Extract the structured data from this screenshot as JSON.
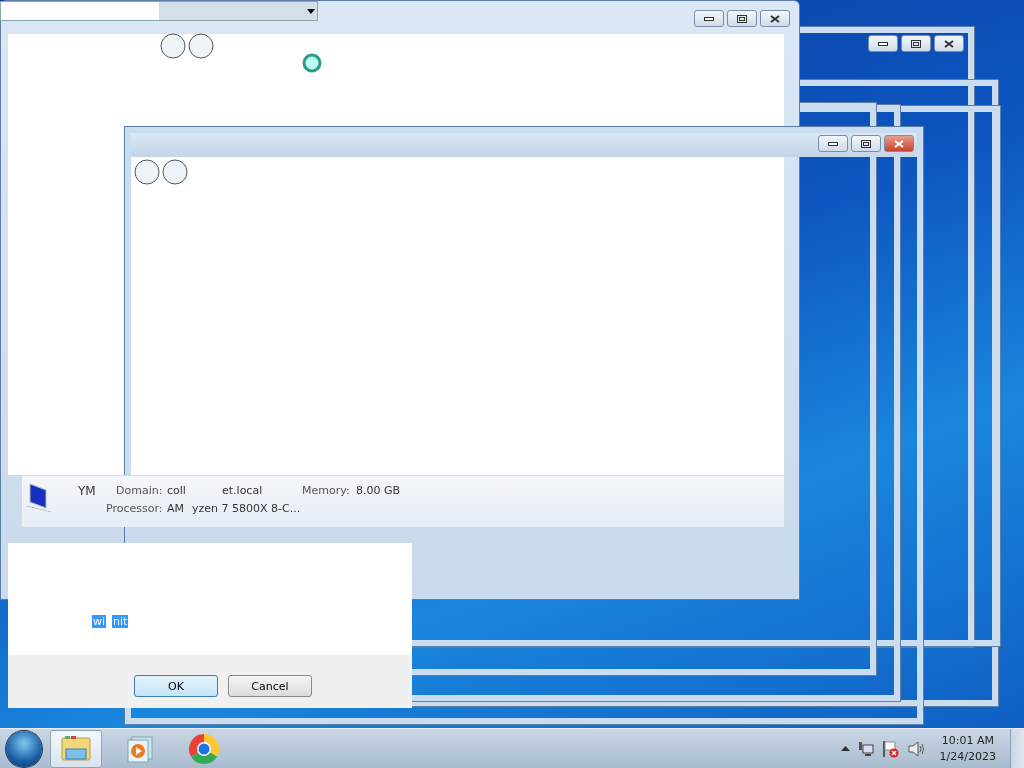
{
  "system_info": {
    "computer_name": "YM",
    "domain_label": "Domain:",
    "domain_value_parts": [
      "coll",
      "et.local"
    ],
    "memory_label": "Memory:",
    "memory_value": "8.00 GB",
    "processor_label": "Processor:",
    "processor_value_parts": [
      "AM",
      "yzen 7 5800X 8-C..."
    ]
  },
  "run_dialog": {
    "input_parts": [
      "wi",
      "nit"
    ],
    "buttons": [
      {
        "label": "OK",
        "default": true
      },
      {
        "label": "Cancel",
        "default": false
      }
    ]
  },
  "taskbar": {
    "pinned": [
      {
        "kind": "explorer",
        "selected": true
      },
      {
        "kind": "media",
        "selected": false
      },
      {
        "kind": "browser",
        "selected": false
      }
    ],
    "clock": {
      "time": "10:01 AM",
      "date": "1/24/2023"
    }
  }
}
